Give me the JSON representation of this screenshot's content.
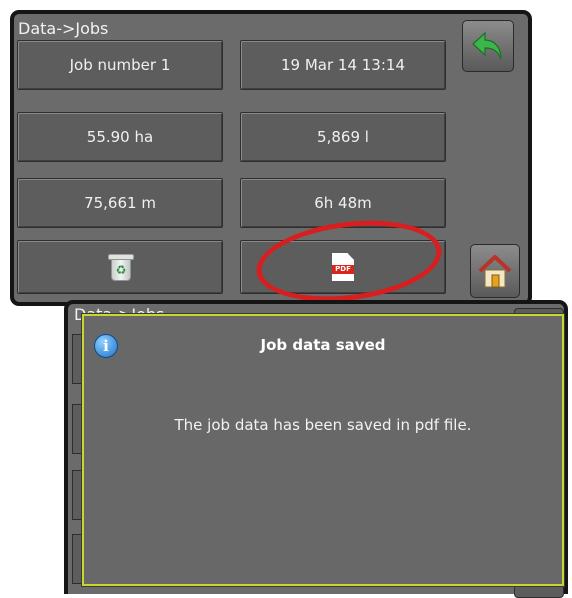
{
  "top_screen": {
    "title": "Data->Jobs",
    "cells": {
      "job_name": "Job number 1",
      "date_time": "19 Mar 14 13:14",
      "area": "55.90 ha",
      "volume": "5,869 l",
      "distance": "75,661 m",
      "duration": "6h 48m"
    },
    "icons": {
      "back": "back-arrow-icon",
      "home": "home-icon",
      "delete": "recycle-bin-icon",
      "export": "pdf-icon"
    },
    "pdf_badge": "PDF"
  },
  "bottom_screen": {
    "title": "Data->Jobs",
    "dialog": {
      "title": "Job data saved",
      "message": "The job data has been saved in pdf file.",
      "icon": "info-icon"
    }
  },
  "colors": {
    "screen_bg": "#6b6b6b",
    "frame": "#151515",
    "highlight": "#d81e1e",
    "dialog_border": "#c8d62e",
    "back_arrow": "#3cb54a"
  }
}
